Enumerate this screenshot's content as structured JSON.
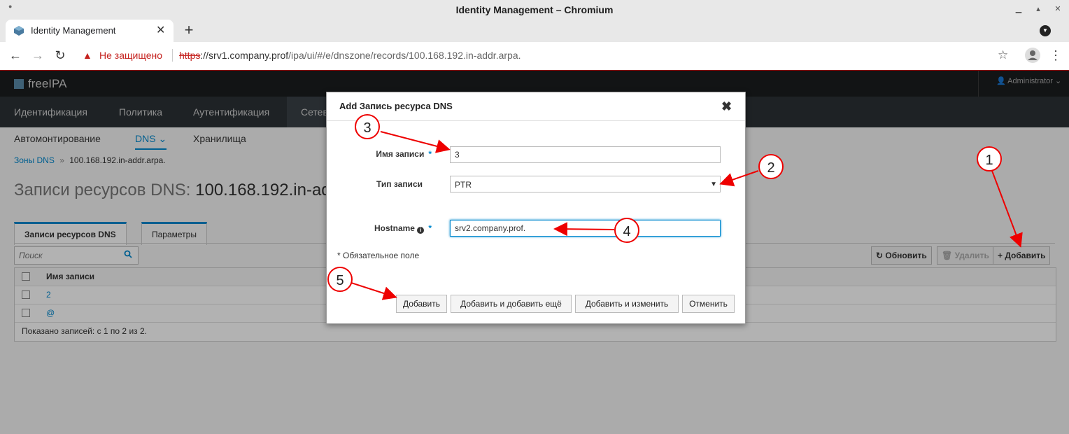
{
  "window": {
    "title": "Identity Management – Chromium"
  },
  "browser": {
    "tab_title": "Identity Management",
    "tab_close": "✕",
    "new_tab": "+",
    "security_text": "Не защищено",
    "url_scheme": "https",
    "url_host": "://srv1.company.prof",
    "url_path": "/ipa/ui/#/e/dnszone/records/100.168.192.in-addr.arpa."
  },
  "app": {
    "logo": "freeIPA",
    "user": "Administrator"
  },
  "main_nav": [
    "Идентификация",
    "Политика",
    "Аутентификация",
    "Сетев"
  ],
  "sub_nav": [
    "Автомонтирование",
    "DNS",
    "Хранилища"
  ],
  "breadcrumb": {
    "root": "Зоны DNS",
    "sep": "»",
    "current": "100.168.192.in-addr.arpa."
  },
  "page": {
    "title_prefix": "Записи ресурсов DNS:",
    "title_zone": "100.168.192.in-ad",
    "tabs": [
      "Записи ресурсов DNS",
      "Параметры"
    ],
    "search_placeholder": "Поиск",
    "buttons": {
      "refresh": "Обновить",
      "delete": "Удалить",
      "add": "Добавить"
    },
    "table": {
      "header": "Имя записи",
      "rows": [
        "2",
        "@"
      ],
      "footer": "Показано записей: с 1 по 2 из 2."
    }
  },
  "dialog": {
    "title": "Add Запись ресурса DNS",
    "close": "✖",
    "fields": {
      "record_name_label": "Имя записи",
      "record_name_value": "3",
      "record_type_label": "Тип записи",
      "record_type_value": "PTR",
      "hostname_label": "Hostname",
      "hostname_value": "srv2.company.prof."
    },
    "required_mark": "*",
    "required_note": "* Обязательное поле",
    "buttons": [
      "Добавить",
      "Добавить и добавить ещё",
      "Добавить и изменить",
      "Отменить"
    ]
  },
  "annotations": [
    "1",
    "2",
    "3",
    "4",
    "5"
  ],
  "colors": {
    "accent": "#0088ce",
    "annotation": "#e00000",
    "header_bg": "#1b1d1f",
    "nav_bg": "#2b3136"
  }
}
